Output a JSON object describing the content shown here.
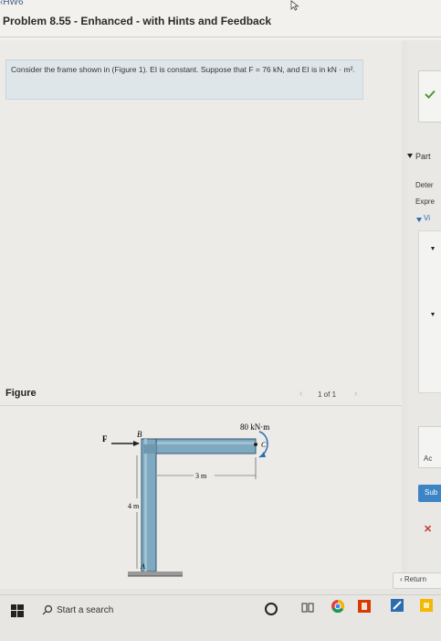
{
  "header": {
    "back_link": "‹HW6",
    "title": "Problem 8.55 - Enhanced - with Hints and Feedback"
  },
  "problem": {
    "text": "Consider the frame shown in (Figure 1). EI is constant. Suppose that F = 76 kN, and EI is in kN · m²."
  },
  "right_panel": {
    "part_label": "Part",
    "determine_label": "Deter",
    "expression_label": "Expre",
    "view_label": "Vi",
    "ac_label": "Ac",
    "submit_label": "Sub",
    "return_label": "‹ Return"
  },
  "figure": {
    "label": "Figure",
    "pager": "1 of 1",
    "labels": {
      "force": "F",
      "moment": "80 kN·m",
      "point_b": "B",
      "point_c": "C",
      "point_a": "A",
      "horizontal_dim": "3 m",
      "vertical_dim": "4 m"
    }
  },
  "taskbar": {
    "search_placeholder": "Start a search"
  },
  "colors": {
    "accent_blue": "#3d84c6",
    "check_green": "#4b9b2f",
    "error_red": "#c5392d"
  }
}
